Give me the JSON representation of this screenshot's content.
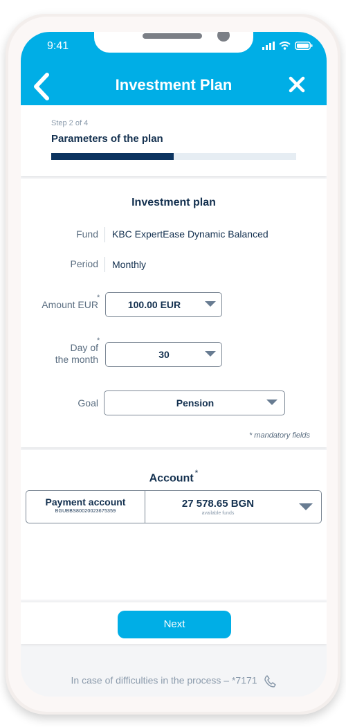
{
  "status_bar": {
    "time": "9:41"
  },
  "header": {
    "title": "Investment Plan"
  },
  "step": {
    "label": "Step 2 of 4",
    "title": "Parameters of the plan",
    "progress": 0.5
  },
  "plan": {
    "section_title": "Investment plan",
    "fund": {
      "label": "Fund",
      "value": "KBC ExpertEase Dynamic Balanced"
    },
    "period": {
      "label": "Period",
      "value": "Monthly"
    },
    "amount": {
      "label": "Amount EUR",
      "required": "*",
      "value": "100.00 EUR"
    },
    "day": {
      "label_line1": "Day of",
      "label_line2": "the month",
      "required": "*",
      "value": "30"
    },
    "goal": {
      "label": "Goal",
      "value": "Pension"
    },
    "mandatory_note": "* mandatory fields"
  },
  "account": {
    "title": "Account",
    "required": "*",
    "name": "Payment account",
    "iban": "BGUBBS80020023675359",
    "balance": "27 578.65 BGN",
    "balance_note": "available funds"
  },
  "footer": {
    "next_label": "Next"
  },
  "help": {
    "text": "In case of difficulties in the process – *7171"
  },
  "colors": {
    "accent": "#00aee6",
    "navy": "#0c3460"
  }
}
